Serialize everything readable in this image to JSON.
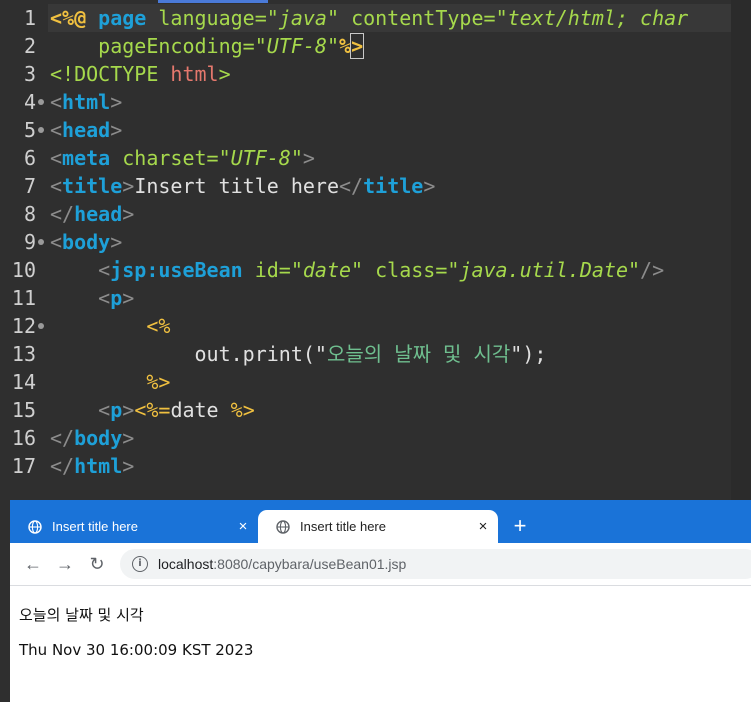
{
  "editor": {
    "lines": [
      {
        "n": "1",
        "fold": false,
        "segs": [
          [
            "k-dir",
            "<%@ "
          ],
          [
            "k-tag",
            "page "
          ],
          [
            "k-attr",
            "language="
          ],
          [
            "k-str",
            "\"java\" "
          ],
          [
            "k-attr",
            "contentType="
          ],
          [
            "k-str",
            "\"text/html; char"
          ]
        ]
      },
      {
        "n": "2",
        "fold": false,
        "segs": [
          [
            "k-txt",
            "    "
          ],
          [
            "k-attr",
            "pageEncoding="
          ],
          [
            "k-str",
            "\"UTF-8\""
          ],
          [
            "k-dir",
            "%"
          ],
          [
            "k-dir cursorbox",
            ">"
          ]
        ]
      },
      {
        "n": "3",
        "fold": false,
        "segs": [
          [
            "k-doc",
            "<!DOCTYPE "
          ],
          [
            "k-name",
            "html"
          ],
          [
            "k-doc",
            ">"
          ]
        ]
      },
      {
        "n": "4",
        "fold": true,
        "segs": [
          [
            "k-pun",
            "<"
          ],
          [
            "k-tag",
            "html"
          ],
          [
            "k-pun",
            ">"
          ]
        ]
      },
      {
        "n": "5",
        "fold": true,
        "segs": [
          [
            "k-pun",
            "<"
          ],
          [
            "k-tag",
            "head"
          ],
          [
            "k-pun",
            ">"
          ]
        ]
      },
      {
        "n": "6",
        "fold": false,
        "segs": [
          [
            "k-pun",
            "<"
          ],
          [
            "k-tag",
            "meta "
          ],
          [
            "k-attr",
            "charset="
          ],
          [
            "k-str",
            "\"UTF-8\""
          ],
          [
            "k-pun",
            ">"
          ]
        ]
      },
      {
        "n": "7",
        "fold": false,
        "segs": [
          [
            "k-pun",
            "<"
          ],
          [
            "k-tag",
            "title"
          ],
          [
            "k-pun",
            ">"
          ],
          [
            "k-txt",
            "Insert title here"
          ],
          [
            "k-pun",
            "</"
          ],
          [
            "k-tag",
            "title"
          ],
          [
            "k-pun",
            ">"
          ]
        ]
      },
      {
        "n": "8",
        "fold": false,
        "segs": [
          [
            "k-pun",
            "</"
          ],
          [
            "k-tag",
            "head"
          ],
          [
            "k-pun",
            ">"
          ]
        ]
      },
      {
        "n": "9",
        "fold": true,
        "segs": [
          [
            "k-pun",
            "<"
          ],
          [
            "k-tag",
            "body"
          ],
          [
            "k-pun",
            ">"
          ]
        ]
      },
      {
        "n": "10",
        "fold": false,
        "segs": [
          [
            "k-txt",
            "    "
          ],
          [
            "k-pun",
            "<"
          ],
          [
            "k-tag",
            "jsp:useBean "
          ],
          [
            "k-attr",
            "id="
          ],
          [
            "k-str",
            "\"date\" "
          ],
          [
            "k-attr",
            "class="
          ],
          [
            "k-str",
            "\"java.util.Date\""
          ],
          [
            "k-pun",
            "/>"
          ]
        ]
      },
      {
        "n": "11",
        "fold": false,
        "segs": [
          [
            "k-txt",
            "    "
          ],
          [
            "k-pun",
            "<"
          ],
          [
            "k-tag",
            "p"
          ],
          [
            "k-pun",
            ">"
          ]
        ]
      },
      {
        "n": "12",
        "fold": true,
        "segs": [
          [
            "k-txt",
            "        "
          ],
          [
            "k-jsp",
            "<%"
          ]
        ]
      },
      {
        "n": "13",
        "fold": false,
        "segs": [
          [
            "k-txt",
            "            out.print(\""
          ],
          [
            "k-kr",
            "오늘의 날짜 및 시각"
          ],
          [
            "k-txt",
            "\");"
          ]
        ]
      },
      {
        "n": "14",
        "fold": false,
        "segs": [
          [
            "k-txt",
            "        "
          ],
          [
            "k-jsp",
            "%>"
          ]
        ]
      },
      {
        "n": "15",
        "fold": false,
        "segs": [
          [
            "k-txt",
            "    "
          ],
          [
            "k-pun",
            "<"
          ],
          [
            "k-tag",
            "p"
          ],
          [
            "k-pun",
            ">"
          ],
          [
            "k-jsp",
            "<%="
          ],
          [
            "k-txt",
            "date "
          ],
          [
            "k-jsp",
            "%>"
          ]
        ]
      },
      {
        "n": "16",
        "fold": false,
        "segs": [
          [
            "k-pun",
            "</"
          ],
          [
            "k-tag",
            "body"
          ],
          [
            "k-pun",
            ">"
          ]
        ]
      },
      {
        "n": "17",
        "fold": false,
        "segs": [
          [
            "k-pun",
            "</"
          ],
          [
            "k-tag",
            "html"
          ],
          [
            "k-pun",
            ">"
          ]
        ]
      }
    ]
  },
  "browser": {
    "tabs": [
      {
        "title": "Insert title here",
        "close": "×"
      },
      {
        "title": "Insert title here",
        "close": "×"
      }
    ],
    "new_tab": "+",
    "nav": {
      "back": "←",
      "forward": "→",
      "reload": "↻"
    },
    "info_icon": "i",
    "url_host": "localhost",
    "url_rest": ":8080/capybara/useBean01.jsp",
    "page_lines": [
      "오늘의 날짜 및 시각",
      "Thu Nov 30 16:00:09 KST 2023"
    ]
  },
  "colors": {
    "editor_bg": "#2f2f2f",
    "tag": "#1ea0d8",
    "attr": "#a6d94c",
    "jsp": "#f0c040",
    "tab_strip": "#1a73d8"
  },
  "icons": [
    "globe-icon",
    "close-icon",
    "plus-icon",
    "back-arrow-icon",
    "forward-arrow-icon",
    "reload-icon",
    "info-icon"
  ]
}
